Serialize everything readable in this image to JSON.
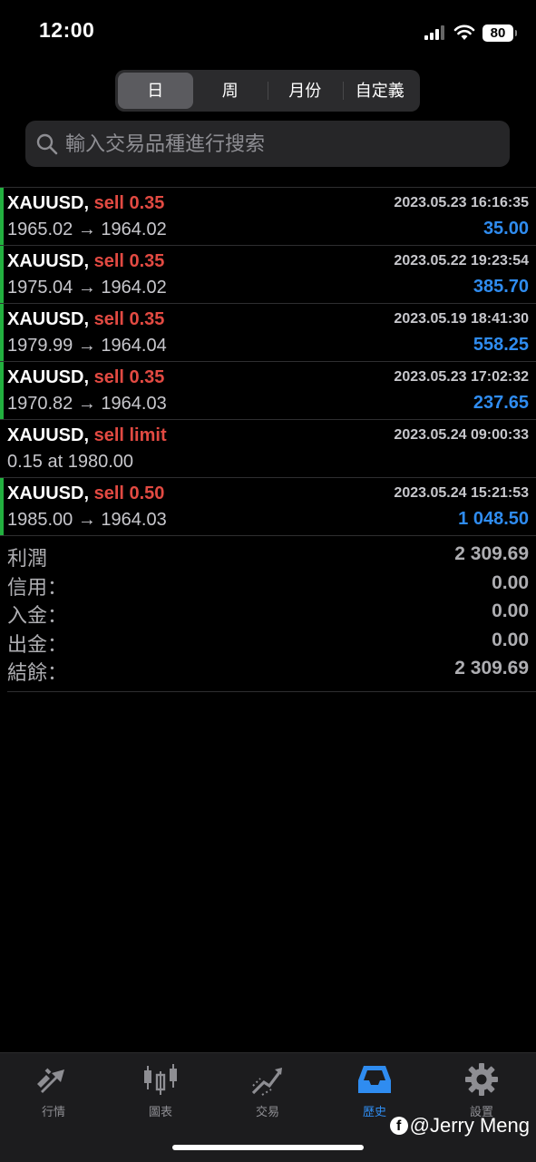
{
  "status_bar": {
    "time": "12:00",
    "battery": "80"
  },
  "period_tabs": [
    {
      "label": "日",
      "active": true
    },
    {
      "label": "周",
      "active": false
    },
    {
      "label": "月份",
      "active": false
    },
    {
      "label": "自定義",
      "active": false
    }
  ],
  "search": {
    "placeholder": "輸入交易品種進行搜索",
    "icon": "search-icon"
  },
  "history": [
    {
      "symbol": "XAUUSD,",
      "side": "sell 0.35",
      "time": "2023.05.23 16:16:35",
      "prices": "1965.02 → 1964.02",
      "profit": "35.00",
      "status_bar_color": "#22b03f"
    },
    {
      "symbol": "XAUUSD,",
      "side": "sell 0.35",
      "time": "2023.05.22 19:23:54",
      "prices": "1975.04 → 1964.02",
      "profit": "385.70",
      "status_bar_color": "#22b03f"
    },
    {
      "symbol": "XAUUSD,",
      "side": "sell 0.35",
      "time": "2023.05.19 18:41:30",
      "prices": "1979.99 → 1964.04",
      "profit": "558.25",
      "status_bar_color": "#22b03f"
    },
    {
      "symbol": "XAUUSD,",
      "side": "sell 0.35",
      "time": "2023.05.23 17:02:32",
      "prices": "1970.82 → 1964.03",
      "profit": "237.65",
      "status_bar_color": "#22b03f"
    },
    {
      "symbol": "XAUUSD,",
      "side": "sell limit",
      "time": "2023.05.24 09:00:33",
      "prices": "0.15 at 1980.00",
      "profit": "",
      "status_bar_color": ""
    },
    {
      "symbol": "XAUUSD,",
      "side": "sell 0.50",
      "time": "2023.05.24 15:21:53",
      "prices": "1985.00 → 1964.03",
      "profit": "1 048.50",
      "status_bar_color": "#22b03f"
    }
  ],
  "summary": [
    {
      "label": "利潤",
      "value": "2 309.69"
    },
    {
      "label": "信用：",
      "value": "0.00"
    },
    {
      "label": "入金：",
      "value": "0.00"
    },
    {
      "label": "出金：",
      "value": "0.00"
    },
    {
      "label": "結餘：",
      "value": "2 309.69"
    }
  ],
  "tab_bar": [
    {
      "label": "行情",
      "icon": "quotes-arrows-icon",
      "active": false
    },
    {
      "label": "圖表",
      "icon": "candlestick-chart-icon",
      "active": false
    },
    {
      "label": "交易",
      "icon": "trade-trend-icon",
      "active": false
    },
    {
      "label": "歷史",
      "icon": "history-inbox-icon",
      "active": true
    },
    {
      "label": "設置",
      "icon": "gear-icon",
      "active": false
    }
  ],
  "watermark": "@Jerry Meng",
  "colors": {
    "buy_bar": "#22b03f",
    "sell_text": "#e24a42",
    "profit_text": "#2f8cf0",
    "active_tab": "#2f8cf0"
  }
}
